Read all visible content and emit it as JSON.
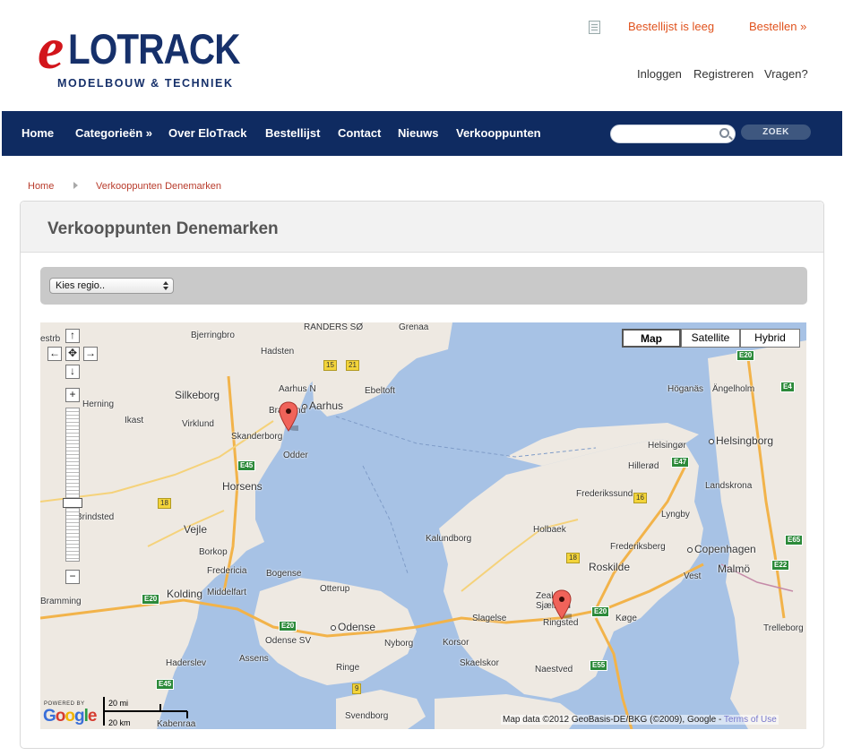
{
  "header": {
    "logo": {
      "initial": "e",
      "word": "LOTRACK",
      "tagline": "MODELBOUW & TECHNIEK"
    },
    "cart_icon": "document-icon",
    "cart_status": "Bestellijst is leeg",
    "order_link": "Bestellen »",
    "user_links": {
      "login": "Inloggen",
      "register": "Registreren",
      "questions": "Vragen?"
    }
  },
  "nav": {
    "items": [
      "Home",
      "Categorieën »",
      "Over EloTrack",
      "Bestellijst",
      "Contact",
      "Nieuws",
      "Verkooppunten"
    ],
    "search_value": "",
    "search_button": "ZOEK"
  },
  "breadcrumb": {
    "home": "Home",
    "current": "Verkooppunten Denemarken"
  },
  "page": {
    "title": "Verkooppunten Denemarken",
    "region_select": "Kies regio.."
  },
  "map": {
    "type_buttons": [
      "Map",
      "Satellite",
      "Hybrid"
    ],
    "active_type": "Map",
    "places": [
      "estrb",
      "Bjerringbro",
      "RANDERS SØ",
      "Grenaa",
      "Hadsten",
      "Aarhus N",
      "Aarhus",
      "Ebeltoft",
      "Herning",
      "Silkeborg",
      "Brabrand",
      "Ikast",
      "Virklund",
      "Skanderborg",
      "Odder",
      "Höganäs",
      "Ängelholm",
      "Helsingør",
      "Helsingborg",
      "Hillerød",
      "Frederikssund",
      "Landskrona",
      "Horsens",
      "Brindsted",
      "Holbaek",
      "Lyngby",
      "Vejle",
      "Kalundborg",
      "Frederiksberg",
      "Copenhagen",
      "Borkop",
      "Roskilde",
      "Malmö",
      "Fredericia",
      "Bogense",
      "Vest",
      "Kolding",
      "Middelfart",
      "Otterup",
      "Zealand",
      "Sjælland",
      "Bramming",
      "Odense",
      "Slagelse",
      "Ringsted",
      "Køge",
      "Trelleborg",
      "Odense SV",
      "Nyborg",
      "Korsor",
      "Assens",
      "Haderslev",
      "Ringe",
      "Skaelskor",
      "Naestved",
      "Svendborg",
      "Kabenraa"
    ],
    "road_numbers": [
      "15",
      "21",
      "E45",
      "18",
      "E20",
      "E47",
      "E55",
      "E65",
      "E22",
      "E4",
      "9",
      "16"
    ],
    "scale": {
      "miles": "20 mi",
      "km": "20 km"
    },
    "powered_by": "POWERED BY",
    "google_logo": "Google",
    "attribution": "Map data ©2012 GeoBasis-DE/BKG (©2009), Google - ",
    "terms": "Terms of Use",
    "markers": [
      "Skanderborg",
      "Ringsted"
    ]
  }
}
